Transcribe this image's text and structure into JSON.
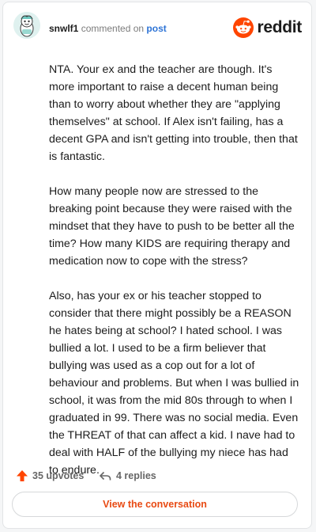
{
  "header": {
    "username": "snwlf1",
    "commented_on": "commented on",
    "post_link": "post",
    "brand": "reddit"
  },
  "comment": {
    "paragraphs": [
      "NTA. Your ex and the teacher are though. It's more important to raise a decent human being than to worry about whether they are \"applying themselves\" at school. If Alex isn't failing, has a decent GPA and isn't getting into trouble, then that is fantastic.",
      "How many people now are stressed to the breaking point because they were raised with the mindset that they have to push to be better all the time? How many KIDS are requiring therapy and medication now to cope with the stress?",
      "Also, has your ex or his teacher stopped to consider that there might possibly be a REASON he hates being at school? I hated school. I was bullied a lot. I used to be a firm believer that bullying was used as a cop out for a lot of behaviour and problems. But when I was bullied in school, it was from the mid 80s through to when I graduated in 99. There was no social media. Even the THREAT of that can affect a kid. I nave had to deal with HALF of the bullying my niece has had to endure."
    ]
  },
  "footer": {
    "upvotes": "35 upvotes",
    "replies": "4 replies",
    "cta": "View the conversation"
  },
  "colors": {
    "reddit_orange": "#ff4500",
    "link_blue": "#2e74d6",
    "cta_text": "#e84a13"
  },
  "icons": {
    "avatar": "snoo-avatar",
    "logo": "reddit-logo",
    "upvote": "upvote-arrow-icon",
    "reply": "reply-arrow-icon"
  }
}
